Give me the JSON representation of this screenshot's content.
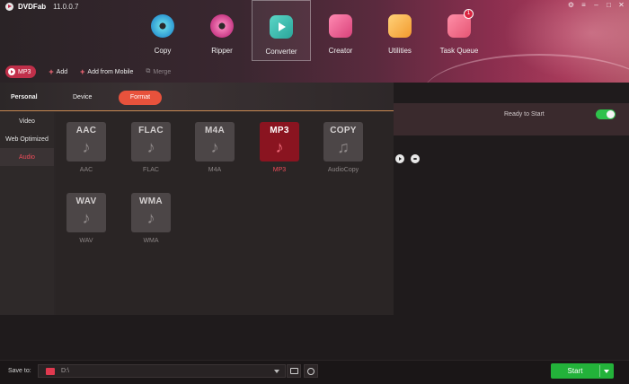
{
  "app": {
    "name": "DVDFab",
    "version": "11.0.0.7"
  },
  "modules": [
    {
      "label": "Copy",
      "icon": "copy-disc-icon"
    },
    {
      "label": "Ripper",
      "icon": "ripper-disc-icon"
    },
    {
      "label": "Converter",
      "icon": "converter-play-icon",
      "active": true
    },
    {
      "label": "Creator",
      "icon": "creator-film-icon"
    },
    {
      "label": "Utilities",
      "icon": "utilities-toolbox-icon"
    },
    {
      "label": "Task Queue",
      "icon": "task-queue-icon",
      "badge": "1"
    }
  ],
  "actions": {
    "current_profile": "MP3",
    "add": "Add",
    "add_from_mobile": "Add from Mobile",
    "merge": "Merge"
  },
  "profile_tabs": {
    "personal": "Personal",
    "device": "Device",
    "format": "Format"
  },
  "sidebar": [
    "Video",
    "Web Optimized",
    "Audio"
  ],
  "formats": [
    {
      "code": "AAC",
      "caption": "AAC"
    },
    {
      "code": "FLAC",
      "caption": "FLAC"
    },
    {
      "code": "M4A",
      "caption": "M4A"
    },
    {
      "code": "MP3",
      "caption": "MP3",
      "active": true
    },
    {
      "code": "COPY",
      "caption": "AudioCopy"
    },
    {
      "code": "WAV",
      "caption": "WAV"
    },
    {
      "code": "WMA",
      "caption": "WMA"
    }
  ],
  "status": {
    "text": "Ready to Start",
    "toggle_on": true
  },
  "save": {
    "label": "Save to:",
    "path": "D:\\"
  },
  "start_button": "Start",
  "colors": {
    "accent": "#e8523c",
    "active_red": "#ef4d5a",
    "start_green": "#23b23a"
  }
}
